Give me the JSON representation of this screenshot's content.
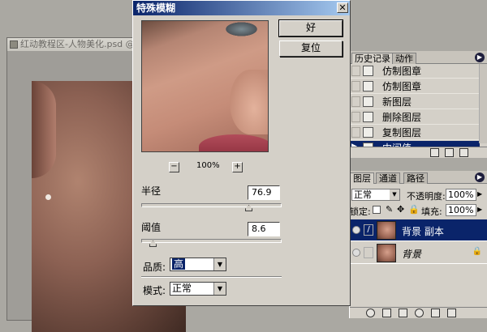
{
  "document": {
    "title": "红动教程区-人物美化.psd @"
  },
  "dialog": {
    "title": "特殊模糊",
    "ok_label": "好",
    "reset_label": "复位",
    "zoom": "100%",
    "zoom_minus": "−",
    "zoom_plus": "+",
    "close": "✕",
    "radius_label": "半径",
    "radius_value": "76.9",
    "threshold_label": "阈值",
    "threshold_value": "8.6",
    "quality_label": "品质:",
    "quality_value": "高",
    "mode_label": "模式:",
    "mode_value": "正常"
  },
  "history_panel": {
    "tabs": [
      "历史记录",
      "动作"
    ],
    "items": [
      {
        "label": "仿制图章",
        "icon": "stamp-icon",
        "selected": false
      },
      {
        "label": "仿制图章",
        "icon": "stamp-icon",
        "selected": false
      },
      {
        "label": "新图层",
        "icon": "document-icon",
        "selected": false
      },
      {
        "label": "删除图层",
        "icon": "document-icon",
        "selected": false
      },
      {
        "label": "复制图层",
        "icon": "document-icon",
        "selected": false
      },
      {
        "label": "中间值",
        "icon": "document-icon",
        "selected": true
      }
    ]
  },
  "layers_panel": {
    "tabs": [
      "图层",
      "通道",
      "路径"
    ],
    "blend_mode": "正常",
    "opacity_label": "不透明度:",
    "opacity_value": "100%",
    "lock_label": "锁定:",
    "fill_label": "填充:",
    "fill_value": "100%",
    "layers": [
      {
        "name": "背景 副本",
        "selected": true
      },
      {
        "name": "背景",
        "selected": false
      }
    ]
  }
}
